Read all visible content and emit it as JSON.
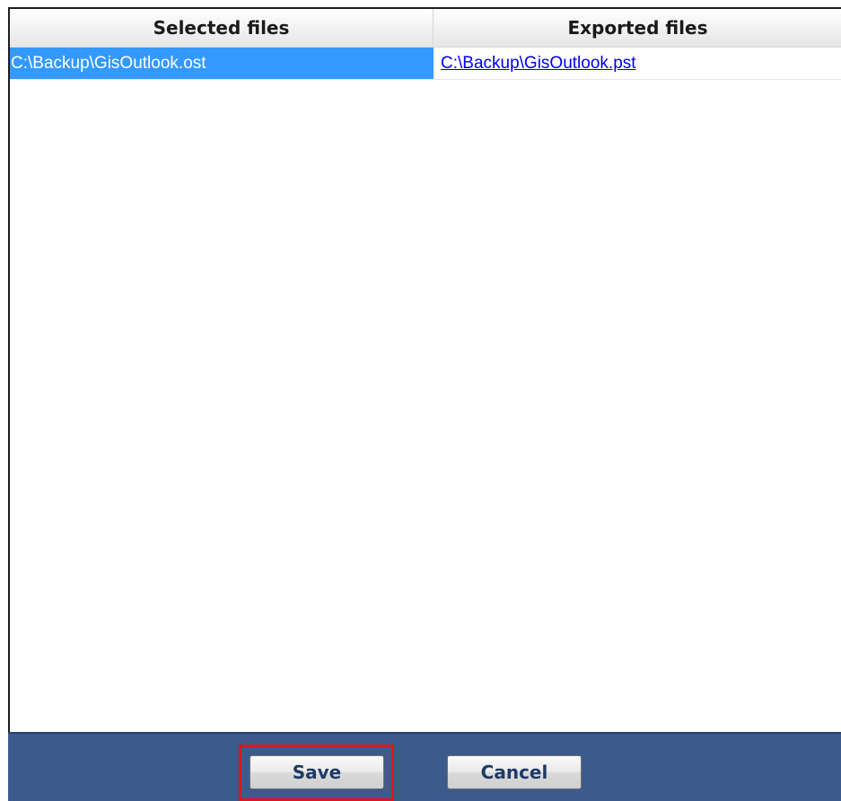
{
  "table": {
    "columns": [
      "Selected files",
      "Exported files"
    ],
    "rows": [
      {
        "selected_file": "C:\\Backup\\GisOutlook.ost",
        "exported_file": "C:\\Backup\\GisOutlook.pst"
      }
    ]
  },
  "footer": {
    "save_label": "Save",
    "cancel_label": "Cancel"
  },
  "colors": {
    "selection": "#3399ff",
    "footer_bg": "#3c5b8c",
    "highlight": "#e0141e",
    "link": "#0000ee"
  }
}
